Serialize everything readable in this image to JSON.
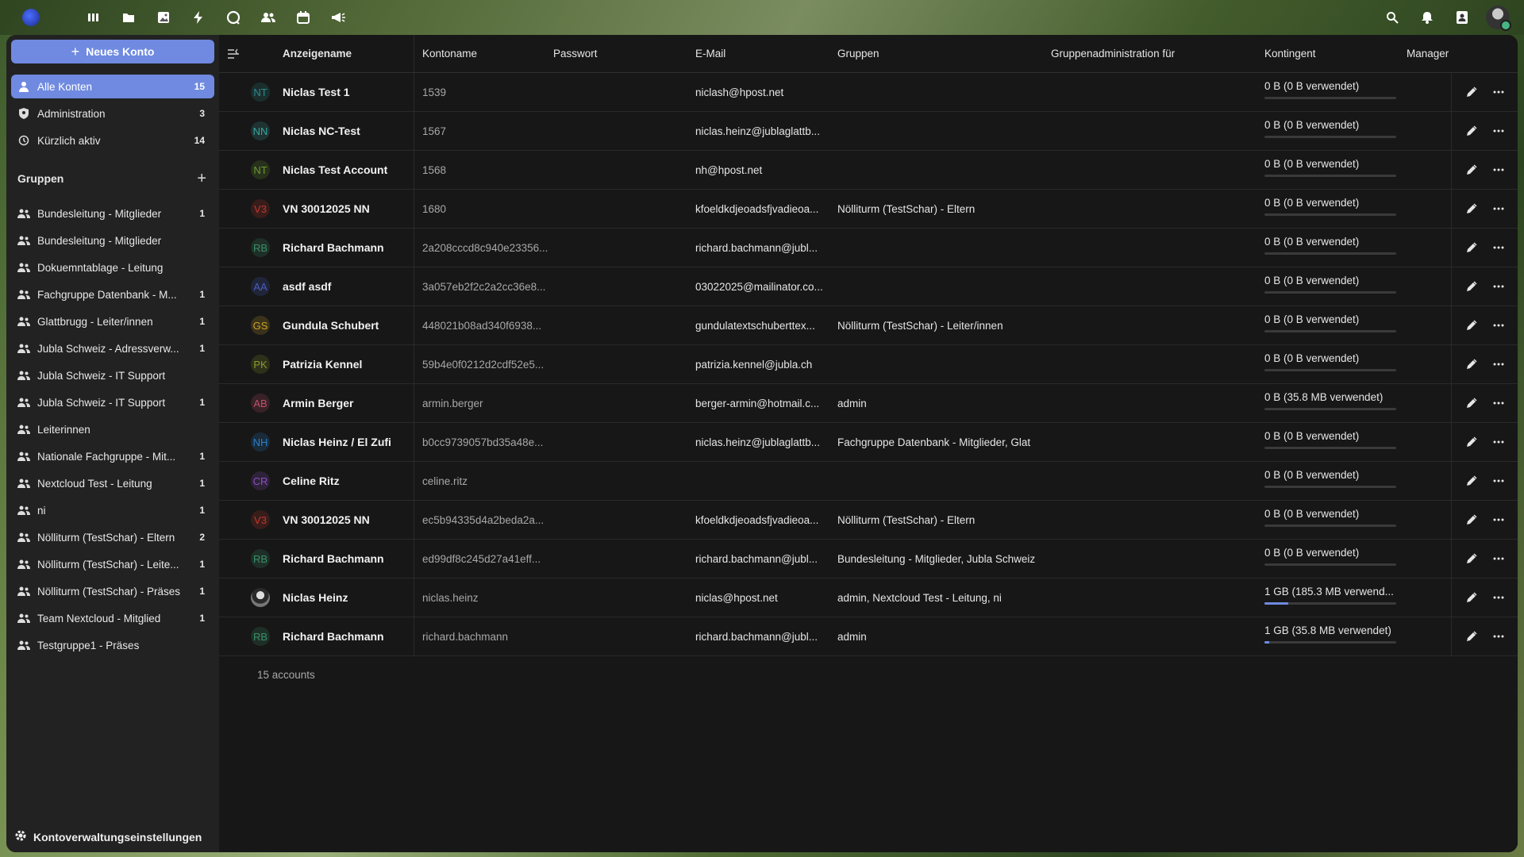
{
  "header": {
    "apps": [
      "dashboard-icon",
      "files-icon",
      "photos-icon",
      "activity-icon",
      "talk-icon",
      "contacts-icon",
      "calendar-icon",
      "announcements-icon"
    ],
    "right": [
      "search-icon",
      "notifications-icon",
      "contacts-menu-icon"
    ]
  },
  "nav": {
    "new_account": "Neues Konto",
    "items": [
      {
        "label": "Alle Konten",
        "count": "15",
        "icon": "user-icon"
      },
      {
        "label": "Administration",
        "count": "3",
        "icon": "shield-icon"
      },
      {
        "label": "Kürzlich aktiv",
        "count": "14",
        "icon": "history-icon"
      }
    ],
    "groups_title": "Gruppen",
    "groups": [
      {
        "label": "Bundesleitung - Mitglieder",
        "count": "1"
      },
      {
        "label": "Bundesleitung - Mitglieder",
        "count": ""
      },
      {
        "label": "Dokuemntablage - Leitung",
        "count": ""
      },
      {
        "label": "Fachgruppe Datenbank - M...",
        "count": "1"
      },
      {
        "label": "Glattbrugg - Leiter/innen",
        "count": "1"
      },
      {
        "label": "Jubla Schweiz - Adressverw...",
        "count": "1"
      },
      {
        "label": "Jubla Schweiz - IT Support",
        "count": ""
      },
      {
        "label": "Jubla Schweiz - IT Support",
        "count": "1"
      },
      {
        "label": "Leiterinnen",
        "count": ""
      },
      {
        "label": "Nationale Fachgruppe - Mit...",
        "count": "1"
      },
      {
        "label": "Nextcloud Test - Leitung",
        "count": "1"
      },
      {
        "label": "ni",
        "count": "1"
      },
      {
        "label": "Nölliturm (TestSchar) - Eltern",
        "count": "2"
      },
      {
        "label": "Nölliturm (TestSchar) - Leite...",
        "count": "1"
      },
      {
        "label": "Nölliturm (TestSchar) - Präses",
        "count": "1"
      },
      {
        "label": "Team Nextcloud - Mitglied",
        "count": "1"
      },
      {
        "label": "Testgruppe1 - Präses",
        "count": ""
      }
    ],
    "settings": "Kontoverwaltungseinstellungen"
  },
  "table": {
    "headers": {
      "display_name": "Anzeigename",
      "account_name": "Kontoname",
      "password": "Passwort",
      "email": "E-Mail",
      "groups": "Gruppen",
      "subadmin": "Gruppenadministration für",
      "quota": "Kontingent",
      "manager": "Manager"
    },
    "rows": [
      {
        "initials": "NT",
        "color": "#2e8b8b",
        "name": "Niclas Test 1",
        "login": "1539",
        "email": "niclash@hpost.net",
        "groups": "",
        "quota": "0 B (0 B verwendet)",
        "used": 0
      },
      {
        "initials": "NN",
        "color": "#3aa6a0",
        "name": "Niclas NC-Test",
        "login": "1567",
        "email": "niclas.heinz@jublaglattb...",
        "groups": "",
        "quota": "0 B (0 B verwendet)",
        "used": 0
      },
      {
        "initials": "NT",
        "color": "#6b9a2e",
        "name": "Niclas Test Account",
        "login": "1568",
        "email": "nh@hpost.net",
        "groups": "",
        "quota": "0 B (0 B verwendet)",
        "used": 0
      },
      {
        "initials": "V3",
        "color": "#c0392b",
        "name": "VN 30012025 NN",
        "login": "1680",
        "email": "kfoeldkdjeoadsfjvadieoa...",
        "groups": "Nölliturm (TestSchar) - Eltern",
        "quota": "0 B (0 B verwendet)",
        "used": 0
      },
      {
        "initials": "RB",
        "color": "#3a8f6a",
        "name": "Richard Bachmann",
        "login": "2a208cccd8c940e23356...",
        "email": "richard.bachmann@jubl...",
        "groups": "",
        "quota": "0 B (0 B verwendet)",
        "used": 0
      },
      {
        "initials": "AA",
        "color": "#4a5fc1",
        "name": "asdf asdf",
        "login": "3a057eb2f2c2a2cc36e8...",
        "email": "03022025@mailinator.co...",
        "groups": "",
        "quota": "0 B (0 B verwendet)",
        "used": 0
      },
      {
        "initials": "GS",
        "color": "#c9a227",
        "name": "Gundula Schubert",
        "login": "448021b08ad340f6938...",
        "email": "gundulatextschuberttex...",
        "groups": "Nölliturm (TestSchar) - Leiter/innen",
        "quota": "0 B (0 B verwendet)",
        "used": 0
      },
      {
        "initials": "PK",
        "color": "#8a9a2a",
        "name": "Patrizia Kennel",
        "login": "59b4e0f0212d2cdf52e5...",
        "email": "patrizia.kennel@jubla.ch",
        "groups": "",
        "quota": "0 B (0 B verwendet)",
        "used": 0
      },
      {
        "initials": "AB",
        "color": "#c0506a",
        "name": "Armin Berger",
        "login": "armin.berger",
        "email": "berger-armin@hotmail.c...",
        "groups": "admin",
        "quota": "0 B (35.8 MB verwendet)",
        "used": 0
      },
      {
        "initials": "NH",
        "color": "#2a7fc9",
        "name": "Niclas Heinz / El Zufi",
        "login": "b0cc9739057bd35a48e...",
        "email": "niclas.heinz@jublaglattb...",
        "groups": "Fachgruppe Datenbank - Mitglieder, Glat",
        "quota": "0 B (0 B verwendet)",
        "used": 0
      },
      {
        "initials": "CR",
        "color": "#8a4fc1",
        "name": "Celine Ritz",
        "login": "celine.ritz",
        "email": "",
        "groups": "",
        "quota": "0 B (0 B verwendet)",
        "used": 0
      },
      {
        "initials": "V3",
        "color": "#c0392b",
        "name": "VN 30012025 NN",
        "login": "ec5b94335d4a2beda2a...",
        "email": "kfoeldkdjeoadsfjvadieoa...",
        "groups": "Nölliturm (TestSchar) - Eltern",
        "quota": "0 B (0 B verwendet)",
        "used": 0
      },
      {
        "initials": "RB",
        "color": "#3a8f6a",
        "name": "Richard Bachmann",
        "login": "ed99df8c245d27a41eff...",
        "email": "richard.bachmann@jubl...",
        "groups": "Bundesleitung - Mitglieder, Jubla Schweiz",
        "quota": "0 B (0 B verwendet)",
        "used": 0
      },
      {
        "initials": "",
        "color": "#555555",
        "name": "Niclas Heinz",
        "login": "niclas.heinz",
        "email": "niclas@hpost.net",
        "groups": "admin, Nextcloud Test - Leitung, ni",
        "quota": "1 GB (185.3 MB verwend...",
        "used": 0.18,
        "photo": true
      },
      {
        "initials": "RB",
        "color": "#3a8f6a",
        "name": "Richard Bachmann",
        "login": "richard.bachmann",
        "email": "richard.bachmann@jubl...",
        "groups": "admin",
        "quota": "1 GB (35.8 MB verwendet)",
        "used": 0.035
      }
    ],
    "footer": "15 accounts"
  },
  "colors": {
    "accent": "#6f8ae0"
  }
}
